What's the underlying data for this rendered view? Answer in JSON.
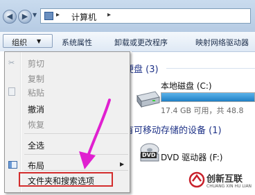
{
  "address_bar": {
    "location": "计算机",
    "sep": "▸"
  },
  "toolbar": {
    "organize": "组织",
    "organize_arrow": "▼",
    "system_properties": "系统属性",
    "uninstall": "卸载或更改程序",
    "map_drive": "映射网络驱动器"
  },
  "content": {
    "hard_disks_header": "硬盘 (3)",
    "local_disk": {
      "name": "本地磁盘 (C:)",
      "free_text": "17.4 GB 可用，共 48.8"
    },
    "removable_header": "有可移动存储的设备 (1)",
    "dvd": {
      "name": "DVD 驱动器 (F:)",
      "badge": "DVD"
    }
  },
  "menu": {
    "items": [
      {
        "label": "剪切",
        "enabled": false
      },
      {
        "label": "复制",
        "enabled": false
      },
      {
        "label": "粘贴",
        "enabled": false
      },
      {
        "label": "撤消",
        "enabled": true
      },
      {
        "label": "恢复",
        "enabled": false
      },
      {
        "label": "全选",
        "enabled": true
      },
      {
        "label": "布局",
        "enabled": true,
        "submenu_arrow": "▶"
      },
      {
        "label": "文件夹和搜索选项",
        "enabled": true
      }
    ]
  },
  "colors": {
    "highlight_box": "#d32c2c",
    "arrow": "#e020d0",
    "logo": "#c8202a",
    "disk_bar": "#2a8fd6"
  },
  "watermark": {
    "text": "创新互联",
    "subtext": "CHUANG XIN HU LIAN"
  }
}
